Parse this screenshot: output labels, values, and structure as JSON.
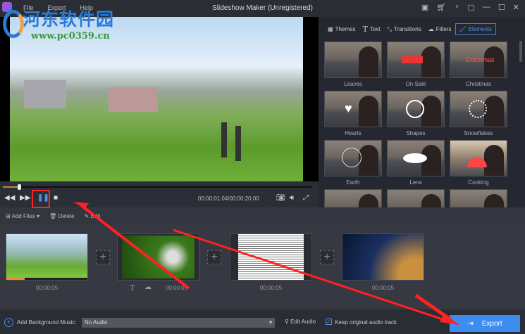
{
  "window": {
    "title": "Slideshow Maker (Unregistered)",
    "menu": [
      "File",
      "Export",
      "Help"
    ]
  },
  "watermark": {
    "line1": "河东软件园",
    "line2": "www.pc0359.cn"
  },
  "tabs": [
    {
      "label": "Themes",
      "icon": "grid-icon"
    },
    {
      "label": "Text",
      "icon": "text-icon"
    },
    {
      "label": "Transitions",
      "icon": "transitions-icon"
    },
    {
      "label": "Filters",
      "icon": "filters-icon"
    },
    {
      "label": "Elements",
      "icon": "elements-icon",
      "active": true
    }
  ],
  "elements": [
    "Leaves",
    "On Sale",
    "Christmas",
    "Hearts",
    "Shapes",
    "Snowflakes",
    "Earth",
    "Lens",
    "Cooking"
  ],
  "player": {
    "time": "00:00:01.04/00:00:20.00",
    "progress_percent": 5.2
  },
  "toolbar": {
    "add_files": "Add Files",
    "delete": "Delete",
    "edit": "Edit"
  },
  "clips": [
    {
      "duration": "00:00:05"
    },
    {
      "duration": "00:00:05"
    },
    {
      "duration": "00:00:05"
    },
    {
      "duration": "00:00:05"
    }
  ],
  "bottom": {
    "add_music": "Add Background Music:",
    "audio_value": "No Audio",
    "edit_audio": "Edit Audio",
    "keep_audio": "Keep original audio track",
    "keep_checked": true,
    "export": "Export"
  },
  "colors": {
    "accent": "#3d8df0",
    "annotation": "#ff2222"
  }
}
